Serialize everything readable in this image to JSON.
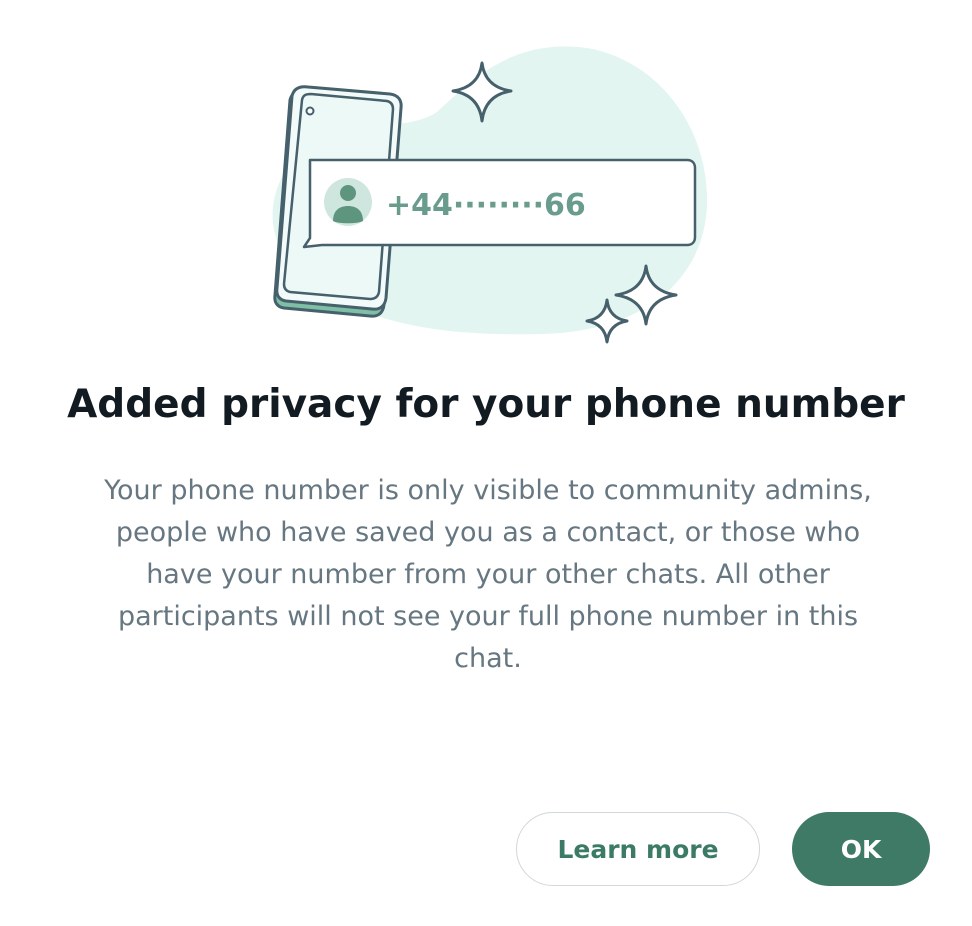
{
  "illustration": {
    "phone_number": "+44········66",
    "icons": [
      "phone-icon",
      "contact-avatar-icon",
      "sparkle-icon"
    ]
  },
  "dialog": {
    "title": "Added privacy for your phone number",
    "body": "Your phone number is only visible to community admins, people who have saved you as a contact, or those who have your number from your other chats. All other participants will not see your full phone number in this chat."
  },
  "buttons": {
    "learn_more": "Learn more",
    "ok": "OK"
  },
  "colors": {
    "accent": "#3e7a65",
    "title": "#111b21",
    "body": "#667781",
    "illustration_bg": "#e2f5f1",
    "outline": "#46606c"
  }
}
